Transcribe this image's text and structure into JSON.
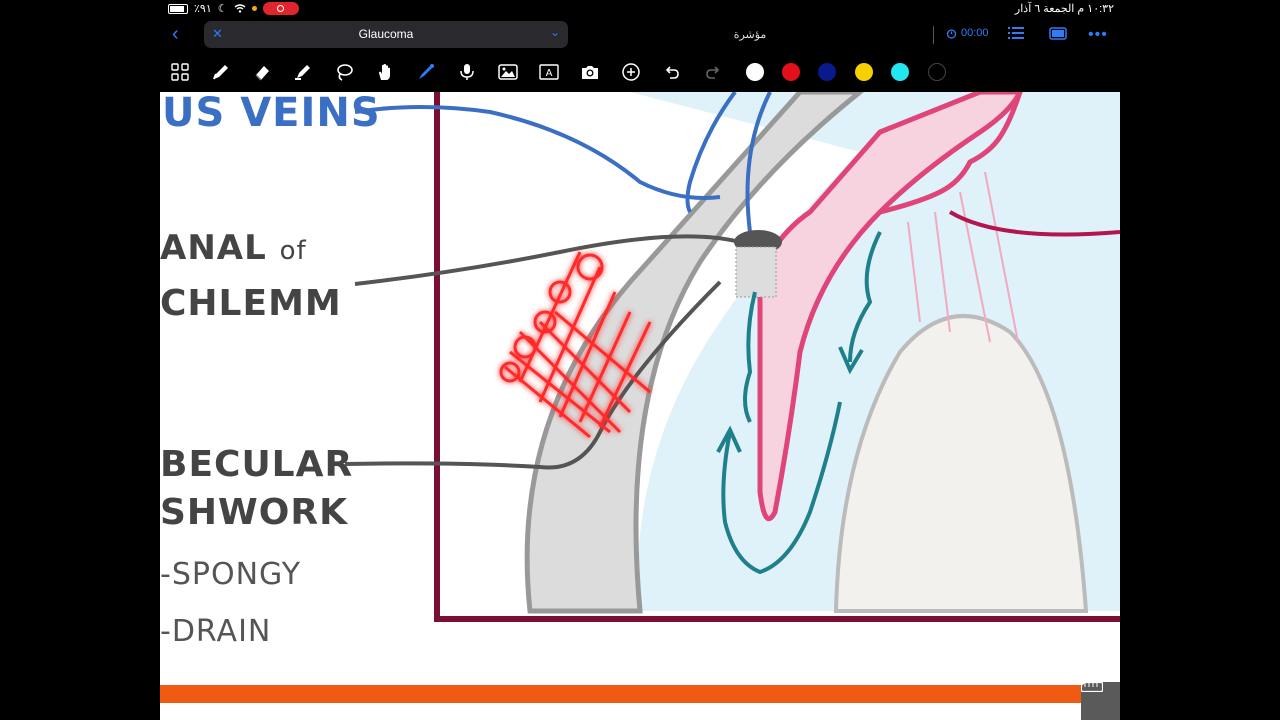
{
  "status_bar": {
    "battery_text": "٪٩١",
    "datetime": "١٠:٣٢ م   الجمعة ٦ آذار"
  },
  "title_bar": {
    "document_name": "Glaucoma",
    "pointer_label": "مؤشرة",
    "timer": "00:00"
  },
  "toolbar": {
    "tools": [
      "grid-icon",
      "pen-icon",
      "eraser-icon",
      "highlighter-icon",
      "lasso-icon",
      "hand-icon",
      "laser-pointer-icon",
      "microphone-icon",
      "image-icon",
      "textbox-icon",
      "camera-icon",
      "add-icon",
      "undo-icon",
      "redo-icon"
    ],
    "colors": [
      "#ffffff",
      "#e3101a",
      "#0a1a8c",
      "#f6d000",
      "#22e6f0",
      "#000000"
    ]
  },
  "diagram": {
    "labels": {
      "veins": "US VEINS",
      "canal_1": "ANAL",
      "canal_of": "of",
      "canal_2": "CHLEMM",
      "trab_1": "BECULAR",
      "trab_2": "SHWORK",
      "spongy": "-SPONGY",
      "drain": "-DRAIN"
    },
    "colors": {
      "frame": "#7a0f33",
      "vein_blue": "#3a6fc4",
      "pink_iris": "#e0457a",
      "aqueous_teal": "#1f7f8a",
      "lens": "#f3f1ee",
      "chamber": "#dff1f9",
      "highlight_red": "#ff2a2a"
    }
  }
}
